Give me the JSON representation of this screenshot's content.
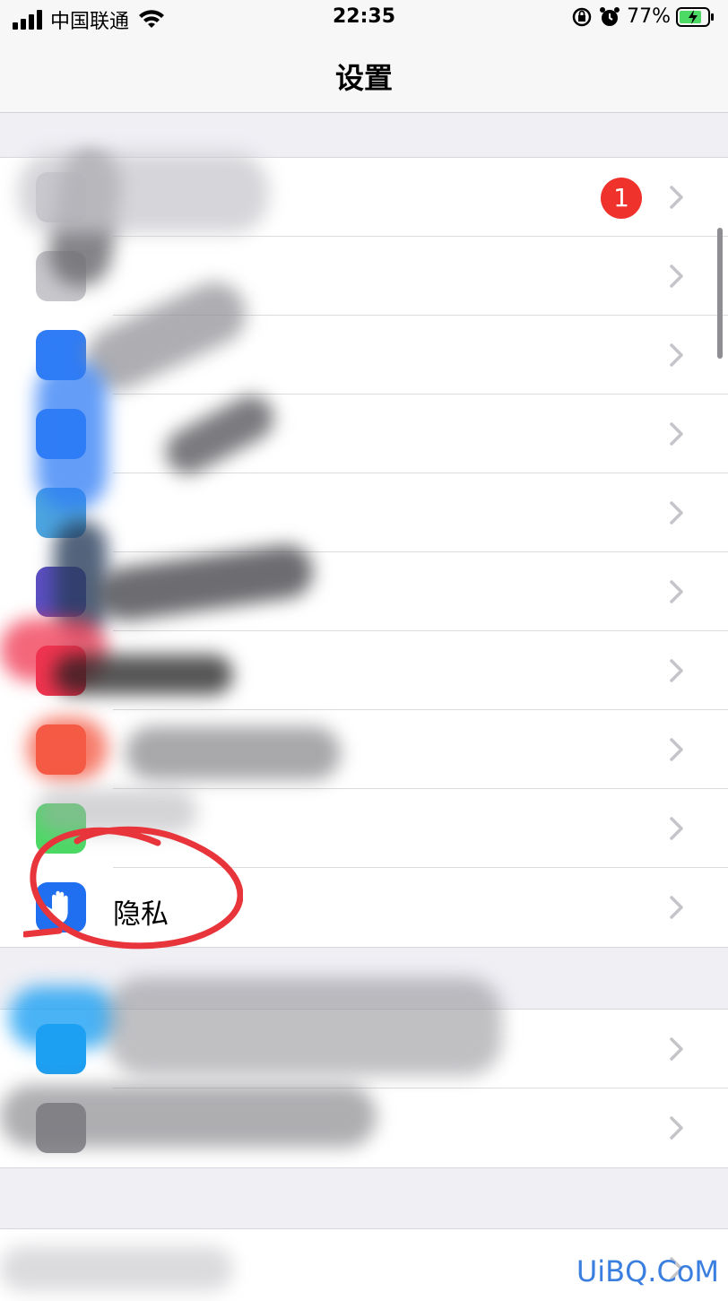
{
  "status_bar": {
    "carrier": "中国联通",
    "time": "22:35",
    "battery": "77%",
    "icons": [
      "signal-icon",
      "wifi-icon",
      "orientation-lock-icon",
      "alarm-icon",
      "battery-charging-icon"
    ]
  },
  "nav": {
    "title": "设置"
  },
  "group1": {
    "badge": "1",
    "rows": [
      {
        "label": "",
        "icon_color": "#c7c7cc"
      },
      {
        "label": "",
        "icon_color": "#c7c7cc"
      },
      {
        "label": "",
        "icon_color": "#2f7cf6"
      },
      {
        "label": "",
        "icon_color": "#2f7cf6"
      },
      {
        "label": "",
        "icon_color": "#4ca5e0"
      },
      {
        "label": "",
        "icon_color": "#5b4fc3"
      },
      {
        "label": "",
        "icon_color": "#f0344f"
      },
      {
        "label": "",
        "icon_color": "#f45a45"
      },
      {
        "label": "",
        "icon_color": "#4cd964"
      },
      {
        "label": "隐私",
        "icon_color": "#1f6ff0",
        "icon": "privacy-hand-icon"
      }
    ]
  },
  "group2": {
    "rows": [
      {
        "label": "",
        "icon_color": "#1da0f2"
      },
      {
        "label": "",
        "icon_color": "#8e8e93"
      }
    ]
  },
  "watermark": "UiBQ.CoM",
  "colors": {
    "annotation": "#e8343b",
    "accent": "#1f6ff0"
  }
}
